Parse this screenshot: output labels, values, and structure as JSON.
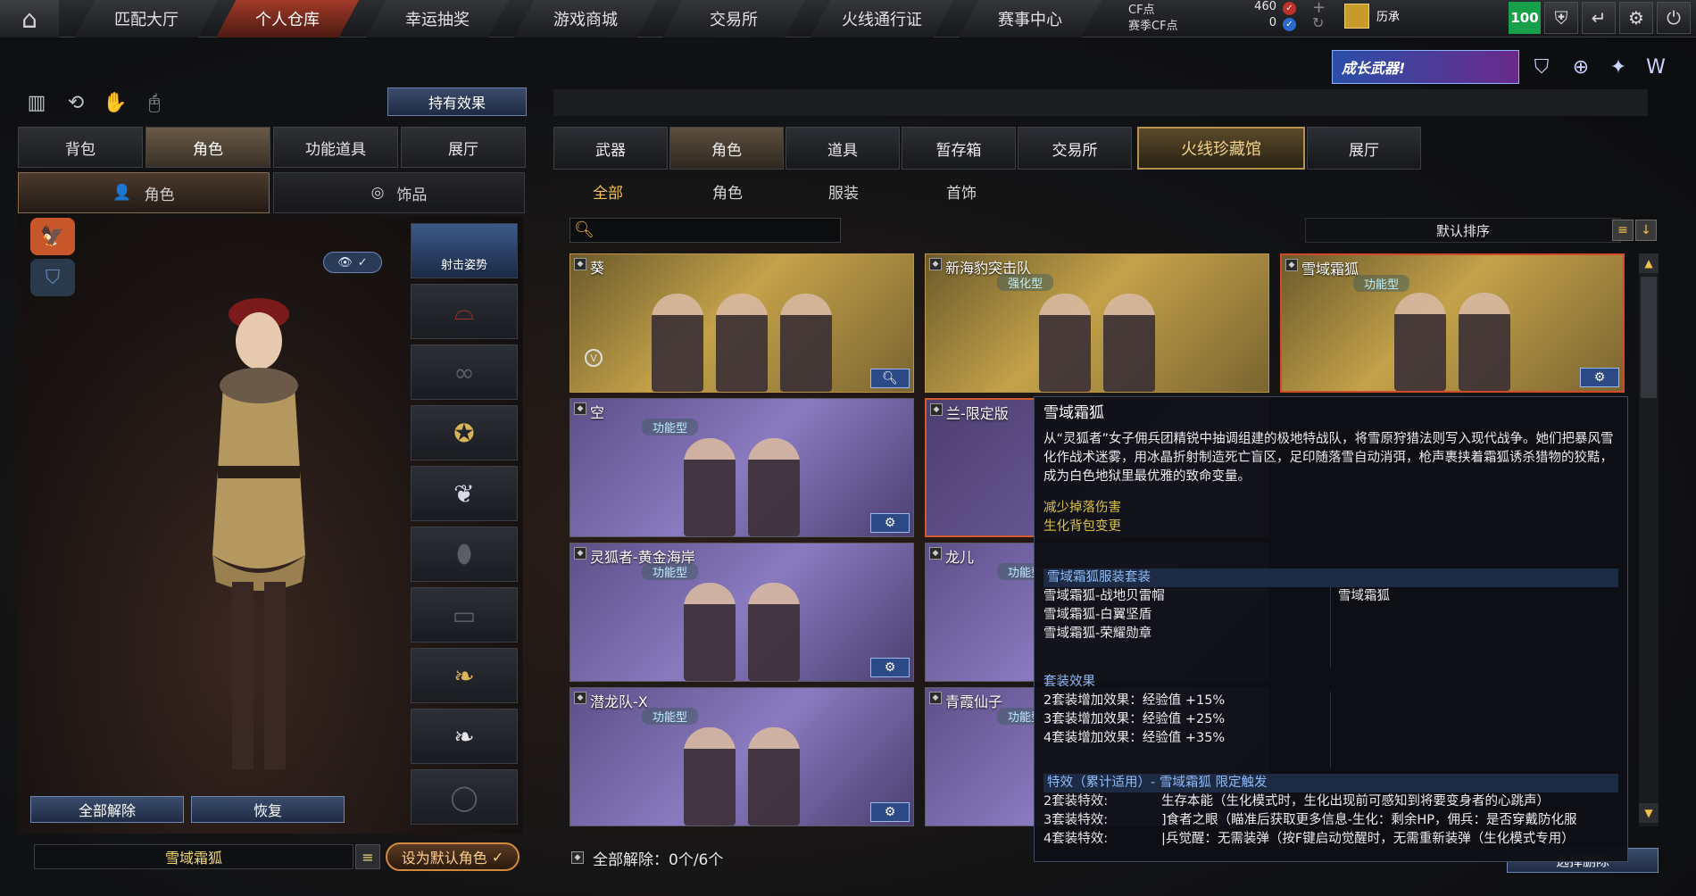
{
  "nav": {
    "tabs": [
      "匹配大厅",
      "个人仓库",
      "幸运抽奖",
      "游戏商城",
      "交易所",
      "火线通行证",
      "赛事中心"
    ],
    "active_tab": "个人仓库"
  },
  "currency": {
    "cf_label": "CF点",
    "cf_value": "460",
    "season_label": "赛季CF点",
    "season_value": "0"
  },
  "rank": {
    "label": "历承"
  },
  "level": "100",
  "promo": {
    "banner": "成长武器!"
  },
  "left": {
    "effect_button": "持有效果",
    "tabs": [
      "背包",
      "角色",
      "功能道具",
      "展厅"
    ],
    "active_tab": "角色",
    "subtabs": [
      "角色",
      "饰品"
    ],
    "active_subtab": "角色",
    "stance_label": "射击姿势",
    "release_all_button": "全部解除",
    "restore_button": "恢复",
    "character_name": "雪域霜狐",
    "set_default_button": "设为默认角色"
  },
  "right": {
    "tabs": [
      "武器",
      "角色",
      "道具",
      "暂存箱",
      "交易所",
      "火线珍藏馆",
      "展厅"
    ],
    "active_tab": "角色",
    "special_tab": "火线珍藏馆",
    "subtabs": [
      "全部",
      "角色",
      "服装",
      "首饰"
    ],
    "active_subtab": "全部",
    "sort_label": "默认排序",
    "cards": [
      {
        "title": "葵",
        "tag": "",
        "style": "gold",
        "action": "search"
      },
      {
        "title": "新海豹突击队",
        "tag": "强化型",
        "style": "gold",
        "action": ""
      },
      {
        "title": "雪域霜狐",
        "tag": "功能型",
        "style": "gold-sel",
        "action": "wrench"
      },
      {
        "title": "空",
        "tag": "功能型",
        "style": "purple",
        "action": "wrench"
      },
      {
        "title": "兰-限定版",
        "tag": "",
        "style": "orange-sel",
        "action": ""
      },
      {
        "title": "灵狐者-黄金海岸",
        "tag": "功能型",
        "style": "purple",
        "action": "wrench"
      },
      {
        "title": "龙儿",
        "tag": "功能型",
        "style": "purple",
        "action": ""
      },
      {
        "title": "潜龙队-X",
        "tag": "功能型",
        "style": "purple",
        "action": "wrench"
      },
      {
        "title": "青霞仙子",
        "tag": "功能型",
        "style": "purple",
        "action": ""
      }
    ],
    "status": "全部解除：0个/6个",
    "bottom_button": "选择删除"
  },
  "tooltip": {
    "title": "雪域霜狐",
    "description": "从“灵狐者”女子佣兵团精锐中抽调组建的极地特战队，将雪原狩猎法则写入现代战争。她们把暴风雪化作战术迷雾，用冰晶折射制造死亡盲区，足印随落雪自动消弭，枪声裹挟着霜狐诱杀猎物的狡黠，成为白色地狱里最优雅的致命变量。",
    "effects": [
      "减少掉落伤害",
      "生化背包变更"
    ],
    "set_section": "雪域霜狐服装套装",
    "set_items": [
      "雪域霜狐-战地贝雷帽",
      "雪域霜狐-白翼坚盾",
      "雪域霜狐-荣耀勋章"
    ],
    "set_right": "雪域霜狐",
    "bonus_section": "套装效果",
    "bonuses": [
      "2套装增加效果：经验值 +15%",
      "3套装增加效果：经验值 +25%",
      "4套装增加效果：经验值 +35%"
    ],
    "special_section": "特效（累计适用）- 雪域霜狐 限定触发",
    "special_labels": [
      "2套装特效:",
      "3套装特效:",
      "4套装特效:"
    ],
    "special_texts": [
      "生存本能（生化模式时，生化出现前可感知到将要变身者的心跳声）",
      "]食者之眼（瞄准后获取更多信息-生化：剩余HP，佣兵：是否穿戴防化服",
      "|兵觉醒：无需装弹（按F键启动觉醒时，无需重新装弹（生化模式专用）"
    ]
  }
}
